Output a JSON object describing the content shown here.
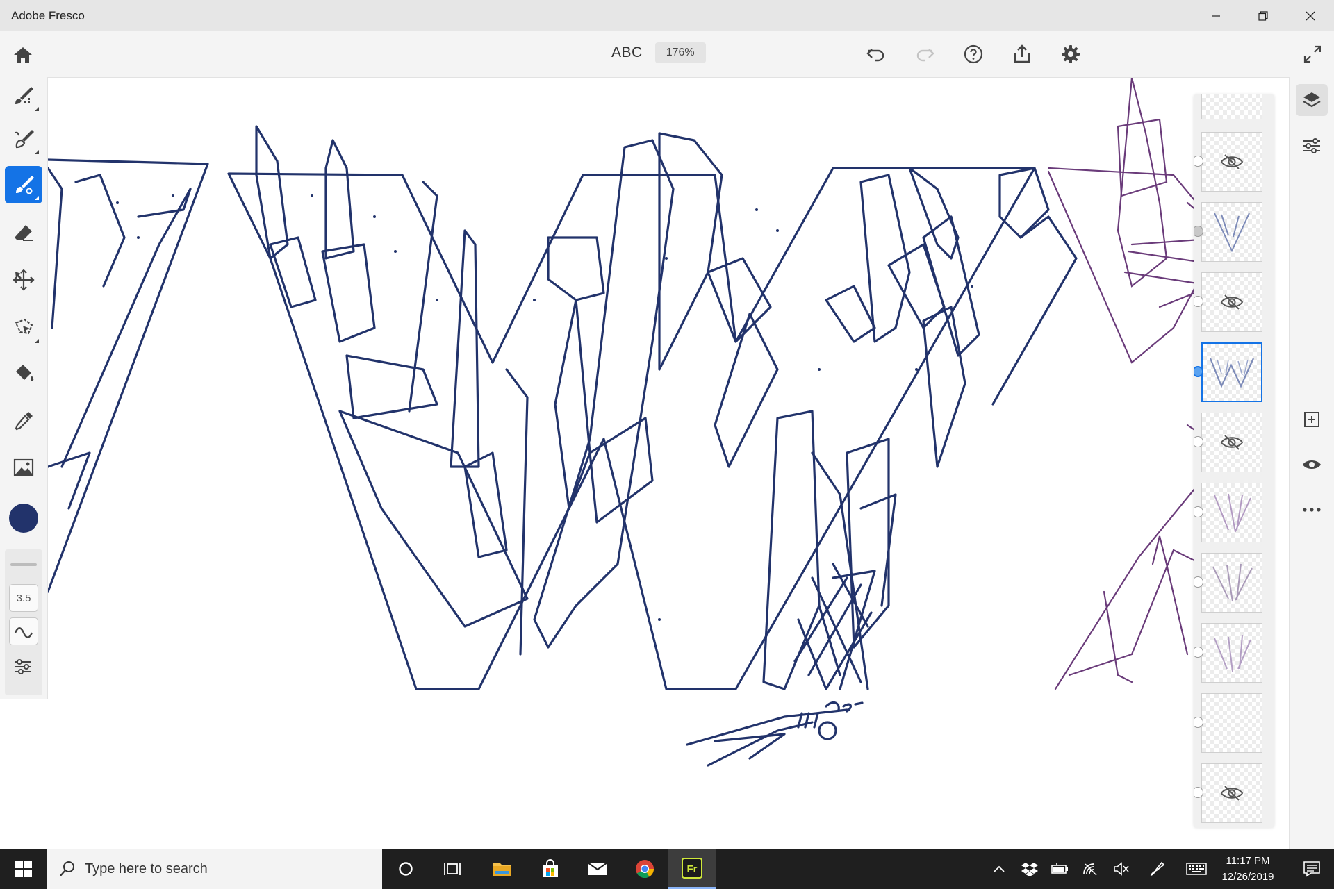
{
  "window": {
    "title": "Adobe Fresco"
  },
  "header": {
    "doc_name": "ABC",
    "zoom": "176%"
  },
  "left_toolbar": {
    "tools": [
      {
        "name": "pixel-brush",
        "icon": "pixel-brush-icon"
      },
      {
        "name": "live-brush",
        "icon": "live-brush-icon"
      },
      {
        "name": "vector-brush",
        "icon": "vector-brush-icon",
        "active": true
      },
      {
        "name": "eraser",
        "icon": "eraser-icon"
      },
      {
        "name": "transform",
        "icon": "move-icon"
      },
      {
        "name": "lasso",
        "icon": "lasso-icon"
      },
      {
        "name": "fill",
        "icon": "paint-bucket-icon"
      },
      {
        "name": "eyedropper",
        "icon": "eyedropper-icon"
      },
      {
        "name": "place-image",
        "icon": "image-icon"
      }
    ],
    "color": "#22336b",
    "brush_size": "3.5"
  },
  "layers": [
    {
      "visible": true
    },
    {
      "visible": false
    },
    {
      "visible": true
    },
    {
      "visible": false
    },
    {
      "visible": true,
      "selected": true
    },
    {
      "visible": false
    },
    {
      "visible": true
    },
    {
      "visible": true
    },
    {
      "visible": true
    },
    {
      "visible": true
    },
    {
      "visible": false
    }
  ],
  "taskbar": {
    "search_placeholder": "Type here to search",
    "time": "11:17 PM",
    "date": "12/26/2019"
  },
  "colors": {
    "accent": "#1473e6",
    "ink": "#22336b",
    "sketch": "#6a3b7a"
  }
}
